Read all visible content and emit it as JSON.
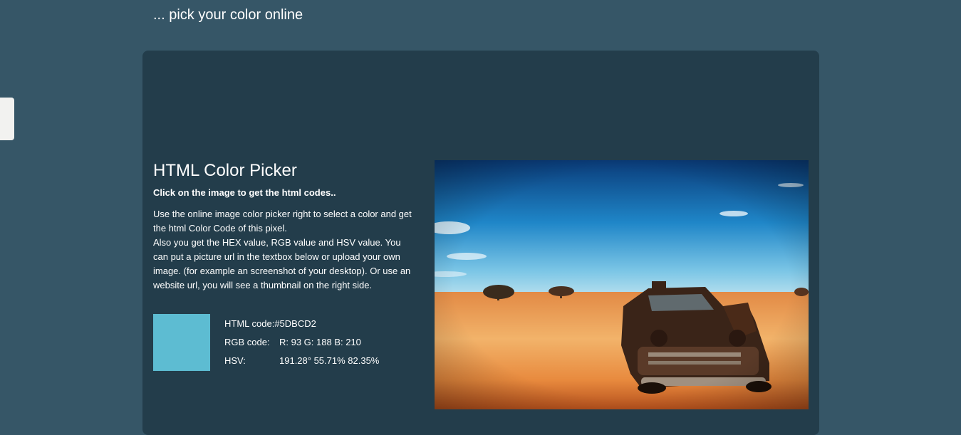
{
  "header": {
    "tagline": "... pick your color online"
  },
  "picker": {
    "title": "HTML Color Picker",
    "subtitle": "Click on the image to get the html codes..",
    "description": [
      "Use the online image color picker right to select a color and get the html Color Code of this pixel.",
      "Also you get the HEX value, RGB value and HSV value. You can put a picture url in the textbox below or upload your own image. (for example an screenshot of your desktop). Or use an website url, you will see a thumbnail on the right side."
    ],
    "swatch_color": "#5DBCD2",
    "html_code_label": "HTML code:",
    "html_code_value": "#5DBCD2",
    "rgb_label": "RGB code:",
    "rgb_value": "R: 93 G: 188 B: 210",
    "hsv_label": "HSV:",
    "hsv_value": "191.28° 55.71% 82.35%"
  },
  "image": {
    "subject": "abandoned rusty car in desert under blue sky"
  }
}
